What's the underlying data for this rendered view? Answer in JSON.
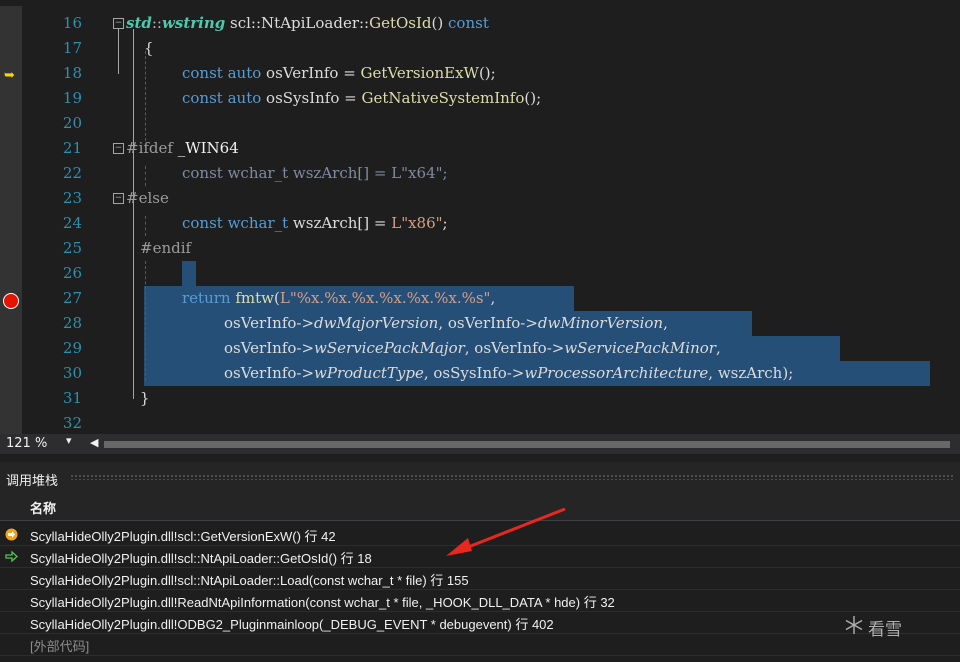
{
  "editor": {
    "line_numbers": [
      "16",
      "17",
      "18",
      "19",
      "20",
      "21",
      "22",
      "23",
      "24",
      "25",
      "26",
      "27",
      "28",
      "29",
      "30",
      "31",
      "32"
    ],
    "lines": {
      "l16": {
        "t1": "std",
        "t2": "::",
        "t3": "wstring",
        "t4": " scl::NtApiLoader::",
        "t5": "GetOsId",
        "t6": "() ",
        "t7": "const"
      },
      "l17": {
        "t1": "{"
      },
      "l18": {
        "t1": "const ",
        "t2": "auto",
        "t3": " osVerInfo = ",
        "t4": "GetVersionExW",
        "t5": "();"
      },
      "l19": {
        "t1": "const ",
        "t2": "auto",
        "t3": " osSysInfo = ",
        "t4": "GetNativeSystemInfo",
        "t5": "();"
      },
      "l21": {
        "t1": "#ifdef ",
        "t2": "_WIN64"
      },
      "l22": {
        "t1": "const wchar_t wszArch[] = L\"x64\";"
      },
      "l23": {
        "t1": "#else"
      },
      "l24": {
        "t1": "const ",
        "t2": "wchar_t",
        "t3": " wszArch[] = ",
        "t4": "L\"x86\"",
        "t5": ";"
      },
      "l25": {
        "t1": "#endif"
      },
      "l27": {
        "t1": "return ",
        "t2": "fmtw",
        "t3": "(",
        "t4": "L\"%x.%x.%x.%x.%x.%x.%s\"",
        "t5": ","
      },
      "l28": {
        "t1": "osVerInfo->",
        "t2": "dwMajorVersion",
        "t3": ", osVerInfo->",
        "t4": "dwMinorVersion",
        "t5": ","
      },
      "l29": {
        "t1": "osVerInfo->",
        "t2": "wServicePackMajor",
        "t3": ", osVerInfo->",
        "t4": "wServicePackMinor",
        "t5": ","
      },
      "l30": {
        "t1": "osVerInfo->",
        "t2": "wProductType",
        "t3": ", osSysInfo->",
        "t4": "wProcessorArchitecture",
        "t5": ", wszArch);"
      },
      "l31": {
        "t1": "}"
      }
    },
    "breakpoint_line": "27",
    "current_line": "18"
  },
  "statusbar": {
    "zoom": "121 %",
    "zoom_dropdown": "▾",
    "scroll_left": "◀"
  },
  "call_stack": {
    "title": "调用堆栈",
    "column_name": "名称",
    "rows": [
      {
        "text": "ScyllaHideOlly2Plugin.dll!scl::GetVersionExW() 行 42"
      },
      {
        "text": "ScyllaHideOlly2Plugin.dll!scl::NtApiLoader::GetOsId() 行 18"
      },
      {
        "text": "ScyllaHideOlly2Plugin.dll!scl::NtApiLoader::Load(const wchar_t * file) 行 155"
      },
      {
        "text": "ScyllaHideOlly2Plugin.dll!ReadNtApiInformation(const wchar_t * file, _HOOK_DLL_DATA * hde) 行 32"
      },
      {
        "text": "ScyllaHideOlly2Plugin.dll!ODBG2_Pluginmainloop(_DEBUG_EVENT * debugevent) 行 402"
      },
      {
        "text": "[外部代码]"
      }
    ]
  },
  "watermark": {
    "text": "看雪"
  },
  "colors": {
    "background": "#1e1e1e",
    "keyword": "#569cd6",
    "function": "#dcdcaa",
    "string": "#d69d85",
    "selection": "#264f78",
    "breakpoint": "#e51400",
    "annotation_arrow": "#e8271f"
  }
}
